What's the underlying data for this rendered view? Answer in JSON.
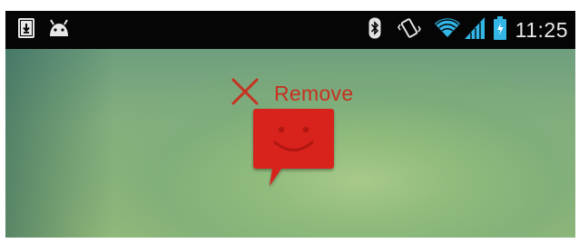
{
  "status_bar": {
    "left_icons": [
      "download-icon",
      "android-icon"
    ],
    "right_icons": [
      "bluetooth-icon",
      "vibrate-icon",
      "wifi-icon",
      "signal-icon",
      "battery-charging-icon"
    ],
    "time": "11:25"
  },
  "drop_target": {
    "icon": "close-icon",
    "label": "Remove",
    "color": "#c8301f"
  },
  "dragged_item": {
    "icon": "messaging-app-icon",
    "color": "#d8221a"
  }
}
